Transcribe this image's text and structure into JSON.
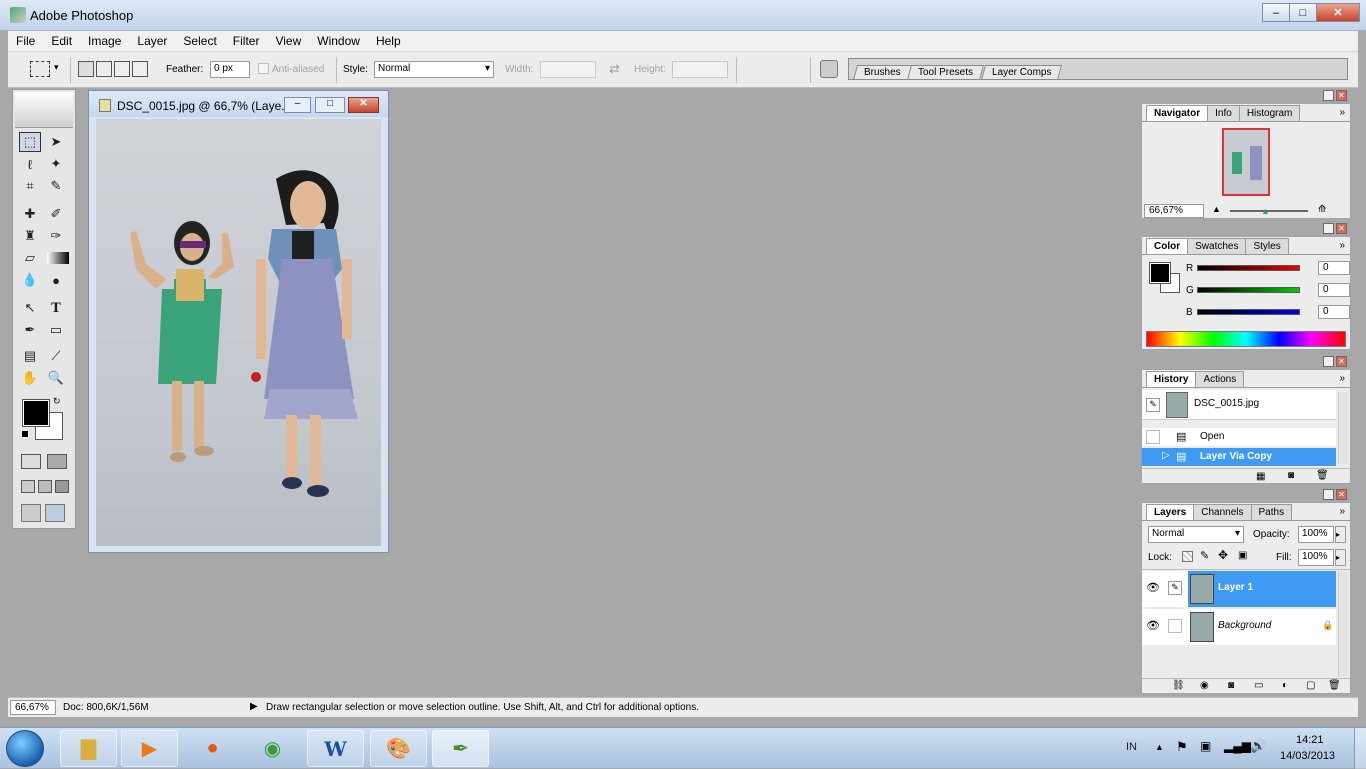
{
  "window": {
    "title": "Adobe Photoshop",
    "min": "–",
    "max": "□",
    "close": "✕"
  },
  "menu": [
    "File",
    "Edit",
    "Image",
    "Layer",
    "Select",
    "Filter",
    "View",
    "Window",
    "Help"
  ],
  "options": {
    "feather_label": "Feather:",
    "feather_value": "0 px",
    "antialias_label": "Anti-aliased",
    "style_label": "Style:",
    "style_value": "Normal",
    "width_label": "Width:",
    "height_label": "Height:"
  },
  "well": {
    "tabs": [
      "Brushes",
      "Tool Presets",
      "Layer Comps"
    ]
  },
  "document": {
    "title": "DSC_0015.jpg @ 66,7% (Laye..."
  },
  "navigator": {
    "tabs": [
      "Navigator",
      "Info",
      "Histogram"
    ],
    "zoom": "66,67%"
  },
  "color": {
    "tabs": [
      "Color",
      "Swatches",
      "Styles"
    ],
    "r_label": "R",
    "g_label": "G",
    "b_label": "B",
    "r": "0",
    "g": "0",
    "b": "0"
  },
  "history": {
    "tabs": [
      "History",
      "Actions"
    ],
    "snapshot": "DSC_0015.jpg",
    "items": [
      "Open",
      "Layer Via Copy"
    ]
  },
  "layers": {
    "tabs": [
      "Layers",
      "Channels",
      "Paths"
    ],
    "blend": "Normal",
    "opacity_label": "Opacity:",
    "opacity": "100%",
    "lock_label": "Lock:",
    "fill_label": "Fill:",
    "fill": "100%",
    "items": [
      "Layer 1",
      "Background"
    ]
  },
  "status": {
    "zoom": "66,67%",
    "doc": "Doc: 800,6K/1,56M",
    "hint": "Draw rectangular selection or move selection outline.  Use Shift, Alt, and Ctrl for additional options."
  },
  "tray": {
    "lang": "IN",
    "time": "14:21",
    "date": "14/03/2013"
  },
  "colors": {
    "accent": "#3f9af4"
  }
}
